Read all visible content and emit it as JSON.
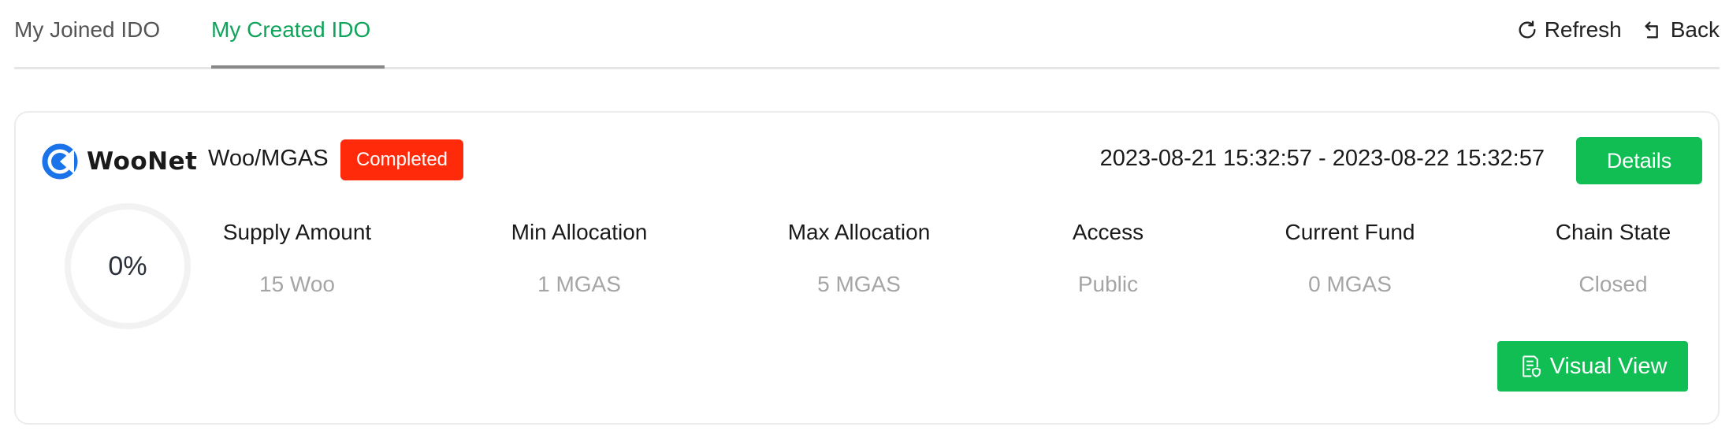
{
  "tabs": [
    {
      "label": "My Joined IDO",
      "active": false
    },
    {
      "label": "My Created IDO",
      "active": true
    }
  ],
  "actions": {
    "refresh_label": "Refresh",
    "refresh_icon": "refresh-icon",
    "back_label": "Back",
    "back_icon": "back-icon"
  },
  "card": {
    "logo_text": "WooNet",
    "pair": "Woo/MGAS",
    "status": "Completed",
    "date_range": "2023-08-21 15:32:57 - 2023-08-22 15:32:57",
    "details_label": "Details",
    "progress_text": "0%",
    "progress_value": 0,
    "stats": [
      {
        "label": "Supply Amount",
        "value": "15 Woo"
      },
      {
        "label": "Min Allocation",
        "value": "1 MGAS"
      },
      {
        "label": "Max Allocation",
        "value": "5 MGAS"
      },
      {
        "label": "Access",
        "value": "Public"
      },
      {
        "label": "Current Fund",
        "value": "0 MGAS"
      },
      {
        "label": "Chain State",
        "value": "Closed"
      }
    ],
    "visual_view_label": "Visual View",
    "visual_view_icon": "document-shield-icon"
  },
  "colors": {
    "accent_green": "#10be54",
    "active_tab": "#10a35a",
    "status_red": "#ff2a0a",
    "muted_value": "#a5a5a5",
    "logo_blue": "#1a73e8"
  }
}
